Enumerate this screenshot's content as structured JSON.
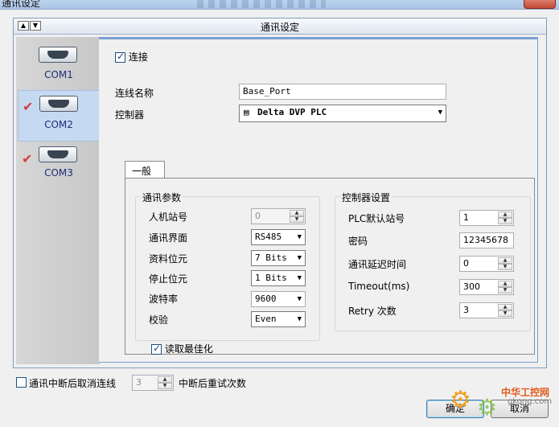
{
  "window": {
    "title": "通讯设定"
  },
  "section": {
    "title": "通讯设定",
    "nav_up": "▲",
    "nav_down": "▼"
  },
  "ports": [
    {
      "label": "COM1",
      "checked": false,
      "selected": false
    },
    {
      "label": "COM2",
      "checked": true,
      "selected": true
    },
    {
      "label": "COM3",
      "checked": true,
      "selected": false
    }
  ],
  "connection": {
    "connect_label": "连接",
    "connect_checked": true,
    "name_label": "连线名称",
    "name_value": "Base_Port",
    "controller_label": "控制器",
    "controller_value": "Delta DVP PLC"
  },
  "tab": {
    "label": "一般"
  },
  "comm_params": {
    "title": "通讯参数",
    "station_label": "人机站号",
    "station_value": "0",
    "interface_label": "通讯界面",
    "interface_value": "RS485",
    "databits_label": "资料位元",
    "databits_value": "7 Bits",
    "stopbits_label": "停止位元",
    "stopbits_value": "1 Bits",
    "baud_label": "波特率",
    "baud_value": "9600",
    "parity_label": "校验",
    "parity_value": "Even"
  },
  "optimize": {
    "label": "读取最佳化",
    "checked": true
  },
  "controller_settings": {
    "title": "控制器设置",
    "plc_station_label": "PLC默认站号",
    "plc_station_value": "1",
    "password_label": "密码",
    "password_value": "12345678",
    "delay_label": "通讯延迟时间",
    "delay_value": "0",
    "timeout_label": "Timeout(ms)",
    "timeout_value": "300",
    "retry_label": "Retry 次数",
    "retry_value": "3"
  },
  "footer": {
    "cancel_on_break_label": "通讯中断后取消连线",
    "retry_count_value": "3",
    "retry_count_label": "中断后重试次数",
    "ok_label": "确定",
    "cancel_label": "取消"
  },
  "watermark": {
    "brand": "中华工控网",
    "site": "gkong.com"
  }
}
